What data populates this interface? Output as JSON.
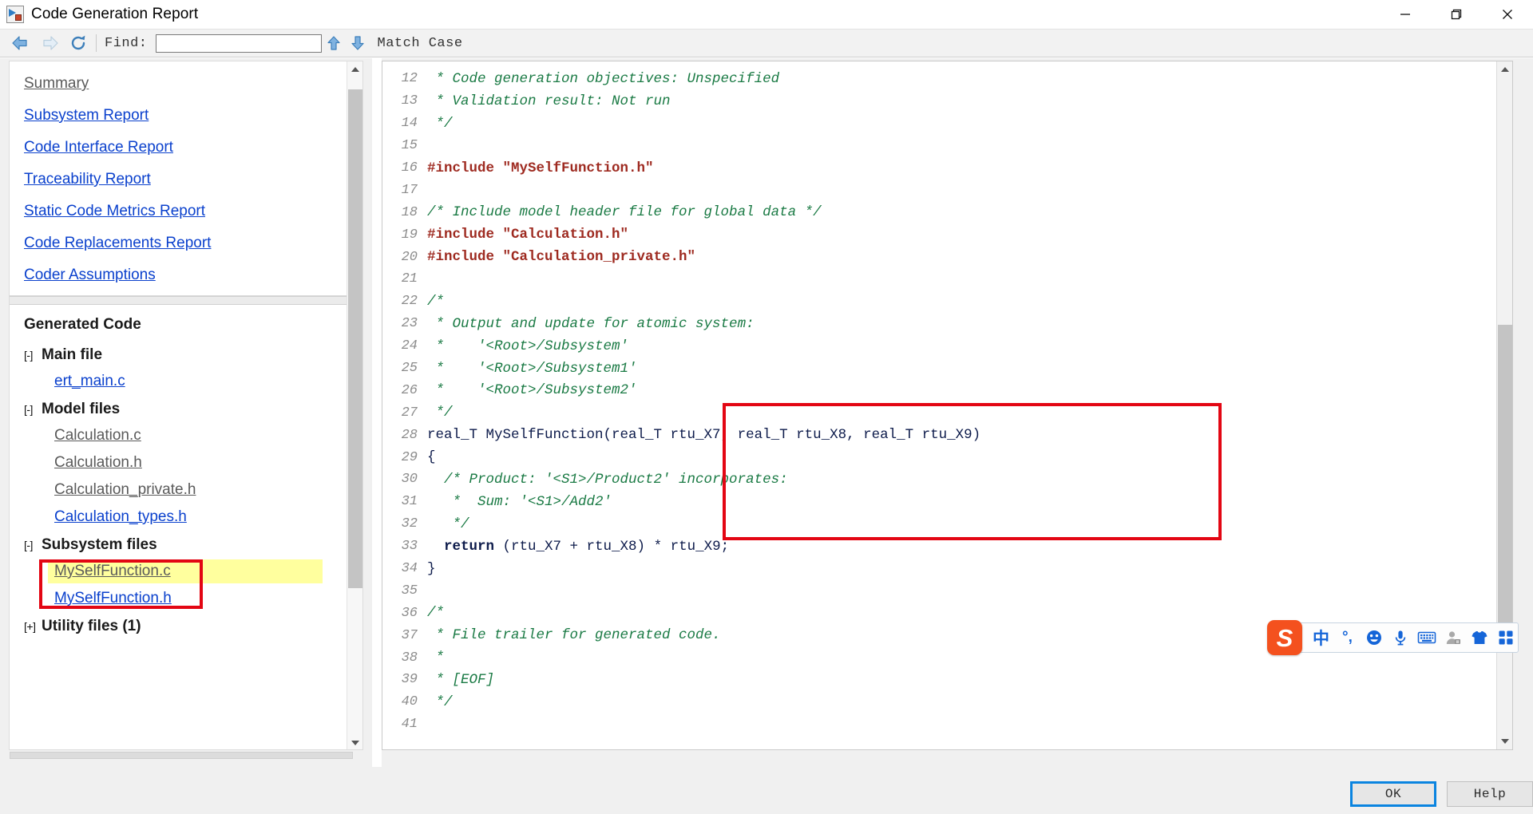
{
  "window": {
    "title": "Code Generation Report",
    "app_icon": "report-icon",
    "controls": [
      {
        "name": "minimize",
        "glyph": "minimize-icon"
      },
      {
        "name": "restore",
        "glyph": "restore-icon"
      },
      {
        "name": "close",
        "glyph": "close-icon"
      }
    ]
  },
  "toolbar": {
    "back_icon": "back-arrow-icon",
    "forward_icon": "forward-arrow-icon",
    "reload_icon": "reload-icon",
    "find_label": "Find:",
    "find_value": "",
    "find_placeholder": "",
    "find_prev_icon": "find-previous-icon",
    "find_next_icon": "find-next-icon",
    "match_case_label": "Match Case"
  },
  "sidebar": {
    "toc": [
      {
        "label": "Summary",
        "state": "visited"
      },
      {
        "label": "Subsystem Report",
        "state": "link"
      },
      {
        "label": "Code Interface Report",
        "state": "link"
      },
      {
        "label": "Traceability Report",
        "state": "link"
      },
      {
        "label": "Static Code Metrics Report",
        "state": "link"
      },
      {
        "label": "Code Replacements Report",
        "state": "link"
      },
      {
        "label": "Coder Assumptions",
        "state": "link"
      }
    ],
    "tree_title": "Generated Code",
    "groups": [
      {
        "toggle": "[-]",
        "label": "Main file",
        "files": [
          {
            "label": "ert_main.c",
            "state": "link"
          }
        ]
      },
      {
        "toggle": "[-]",
        "label": "Model files",
        "files": [
          {
            "label": "Calculation.c",
            "state": "visited"
          },
          {
            "label": "Calculation.h",
            "state": "visited"
          },
          {
            "label": "Calculation_private.h",
            "state": "visited"
          },
          {
            "label": "Calculation_types.h",
            "state": "link"
          }
        ]
      },
      {
        "toggle": "[-]",
        "label": "Subsystem files",
        "files": [
          {
            "label": "MySelfFunction.c",
            "state": "visited",
            "highlight": "yellow"
          },
          {
            "label": "MySelfFunction.h",
            "state": "link"
          }
        ]
      },
      {
        "toggle": "[+]",
        "label": "Utility files (1)",
        "files": []
      }
    ],
    "annotation_box_color": "#e30613",
    "highlight_color": "#ffff9e"
  },
  "code_view": {
    "first_visible_line": 12,
    "last_visible_line": 41,
    "annotation_box_color": "#e30613",
    "lines": [
      {
        "n": "12",
        "segments": [
          {
            "t": " * Code generation objectives: Unspecified",
            "c": "cmt"
          }
        ]
      },
      {
        "n": "13",
        "segments": [
          {
            "t": " * Validation result: Not run",
            "c": "cmt"
          }
        ]
      },
      {
        "n": "14",
        "segments": [
          {
            "t": " */",
            "c": "cmt"
          }
        ]
      },
      {
        "n": "15",
        "segments": [
          {
            "t": "",
            "c": "code-txt"
          }
        ]
      },
      {
        "n": "16",
        "segments": [
          {
            "t": "#include \"MySelfFunction.h\"",
            "c": "inc"
          }
        ]
      },
      {
        "n": "17",
        "segments": [
          {
            "t": "",
            "c": "code-txt"
          }
        ]
      },
      {
        "n": "18",
        "segments": [
          {
            "t": "/* Include model header file for global data */",
            "c": "cmt"
          }
        ]
      },
      {
        "n": "19",
        "segments": [
          {
            "t": "#include \"Calculation.h\"",
            "c": "inc"
          }
        ]
      },
      {
        "n": "20",
        "segments": [
          {
            "t": "#include \"Calculation_private.h\"",
            "c": "inc"
          }
        ]
      },
      {
        "n": "21",
        "segments": [
          {
            "t": "",
            "c": "code-txt"
          }
        ]
      },
      {
        "n": "22",
        "segments": [
          {
            "t": "/*",
            "c": "cmt"
          }
        ]
      },
      {
        "n": "23",
        "segments": [
          {
            "t": " * Output and update for atomic system:",
            "c": "cmt"
          }
        ]
      },
      {
        "n": "24",
        "segments": [
          {
            "t": " *    '<Root>/Subsystem'",
            "c": "cmt"
          }
        ]
      },
      {
        "n": "25",
        "segments": [
          {
            "t": " *    '<Root>/Subsystem1'",
            "c": "cmt"
          }
        ]
      },
      {
        "n": "26",
        "segments": [
          {
            "t": " *    '<Root>/Subsystem2'",
            "c": "cmt"
          }
        ]
      },
      {
        "n": "27",
        "segments": [
          {
            "t": " */",
            "c": "cmt"
          }
        ]
      },
      {
        "n": "28",
        "segments": [
          {
            "t": "real_T MySelfFunction(real_T rtu_X7, real_T rtu_X8, real_T rtu_X9)",
            "c": "code-txt"
          }
        ]
      },
      {
        "n": "29",
        "segments": [
          {
            "t": "{",
            "c": "code-txt"
          }
        ]
      },
      {
        "n": "30",
        "segments": [
          {
            "t": "  /* Product: '<S1>/Product2' incorporates:",
            "c": "cmt"
          }
        ]
      },
      {
        "n": "31",
        "segments": [
          {
            "t": "   *  Sum: '<S1>/Add2'",
            "c": "cmt"
          }
        ]
      },
      {
        "n": "32",
        "segments": [
          {
            "t": "   */",
            "c": "cmt"
          }
        ]
      },
      {
        "n": "33",
        "segments": [
          {
            "t": "  ",
            "c": "code-txt"
          },
          {
            "t": "return",
            "c": "kw"
          },
          {
            "t": " (rtu_X7 + rtu_X8) * rtu_X9;",
            "c": "code-txt"
          }
        ]
      },
      {
        "n": "34",
        "segments": [
          {
            "t": "}",
            "c": "code-txt"
          }
        ]
      },
      {
        "n": "35",
        "segments": [
          {
            "t": "",
            "c": "code-txt"
          }
        ]
      },
      {
        "n": "36",
        "segments": [
          {
            "t": "/*",
            "c": "cmt"
          }
        ]
      },
      {
        "n": "37",
        "segments": [
          {
            "t": " * File trailer for generated code.",
            "c": "cmt"
          }
        ]
      },
      {
        "n": "38",
        "segments": [
          {
            "t": " *",
            "c": "cmt"
          }
        ]
      },
      {
        "n": "39",
        "segments": [
          {
            "t": " * [EOF]",
            "c": "cmt"
          }
        ]
      },
      {
        "n": "40",
        "segments": [
          {
            "t": " */",
            "c": "cmt"
          }
        ]
      },
      {
        "n": "41",
        "segments": [
          {
            "t": "",
            "c": "code-txt"
          }
        ]
      }
    ]
  },
  "ime_toolbar": {
    "logo_label": "S",
    "logo_color": "#f4511e",
    "items": [
      {
        "name": "chinese-mode-icon",
        "glyph": "中"
      },
      {
        "name": "punctuation-mode-icon",
        "glyph": "°,"
      },
      {
        "name": "emoji-icon",
        "glyph": "emoji"
      },
      {
        "name": "microphone-icon",
        "glyph": "mic"
      },
      {
        "name": "soft-keyboard-icon",
        "glyph": "keyboard"
      },
      {
        "name": "account-icon",
        "glyph": "account"
      },
      {
        "name": "skin-icon",
        "glyph": "tshirt"
      },
      {
        "name": "toolbox-icon",
        "glyph": "grid"
      }
    ]
  },
  "footer": {
    "ok_label": "OK",
    "help_label": "Help",
    "focus_color": "#0a84e0"
  }
}
